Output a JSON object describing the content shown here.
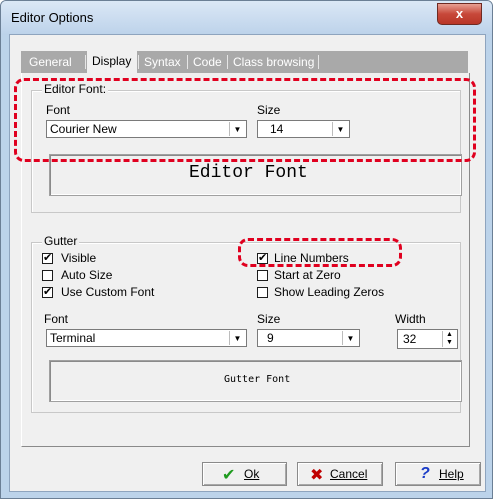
{
  "window": {
    "title": "Editor Options",
    "close_symbol": "x"
  },
  "tabs": [
    {
      "label": "General",
      "active": false
    },
    {
      "label": "Display",
      "active": true
    },
    {
      "label": "Syntax",
      "active": false
    },
    {
      "label": "Code",
      "active": false
    },
    {
      "label": "Class browsing",
      "active": false
    }
  ],
  "editor_font": {
    "group_title": "Editor Font:",
    "font_label": "Font",
    "font_value": "Courier New",
    "size_label": "Size",
    "size_value": "14",
    "preview_text": "Editor Font"
  },
  "gutter": {
    "group_title": "Gutter",
    "checkboxes": {
      "visible": {
        "label": "Visible",
        "checked": true
      },
      "auto_size": {
        "label": "Auto Size",
        "checked": false
      },
      "use_custom_font": {
        "label": "Use Custom Font",
        "checked": true
      },
      "line_numbers": {
        "label": "Line Numbers",
        "checked": true
      },
      "start_at_zero": {
        "label": "Start at Zero",
        "checked": false
      },
      "show_leading_zeros": {
        "label": "Show Leading Zeros",
        "checked": false
      }
    },
    "font_label": "Font",
    "font_value": "Terminal",
    "size_label": "Size",
    "size_value": "9",
    "width_label": "Width",
    "width_value": "32",
    "preview_text": "Gutter Font"
  },
  "buttons": {
    "ok": "Ok",
    "cancel": "Cancel",
    "help": "Help"
  },
  "check_mark": "✔",
  "colors": {
    "annotation": "#e0001f",
    "ok_icon": "#1f9b1f",
    "cancel_icon": "#c00000",
    "help_icon": "#1a3cc8"
  }
}
